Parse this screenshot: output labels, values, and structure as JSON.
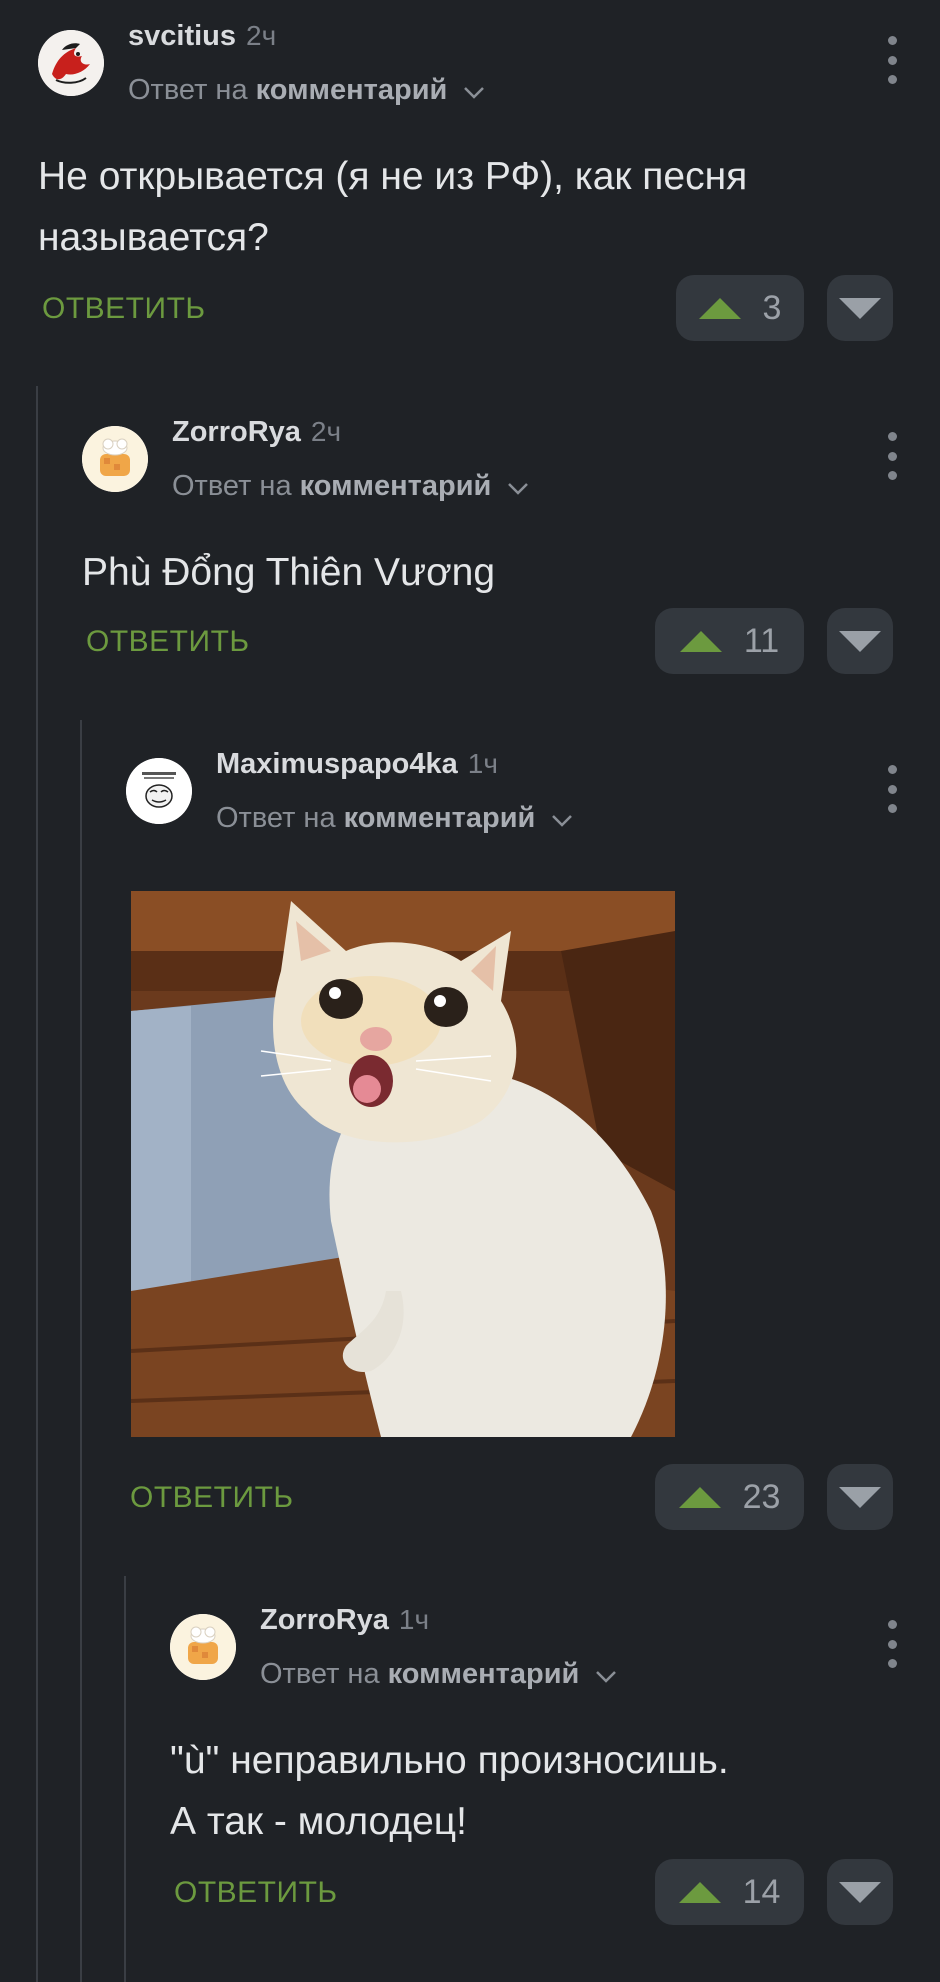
{
  "ui": {
    "reply_to_prefix": "Ответ на",
    "reply_to_target": "комментарий",
    "reply_button": "ОТВЕТИТЬ"
  },
  "colors": {
    "background": "#1f2226",
    "accent_green": "#6c9a3f",
    "vote_box": "#33383e"
  },
  "comments": [
    {
      "author": "svcitius",
      "time": "2ч",
      "text_lines": [
        "Не открывается (я не из РФ), как песня",
        "называется?"
      ],
      "rating": "3",
      "avatar_icon": "red-dragon-avatar-icon"
    },
    {
      "author": "ZorroRya",
      "time": "2ч",
      "text_lines": [
        "Phù Đổng Thiên Vương"
      ],
      "rating": "11",
      "avatar_icon": "cookie-chef-avatar-icon"
    },
    {
      "author": "Maximuspapo4ka",
      "time": "1ч",
      "image": "coughing-cat-photo",
      "rating": "23",
      "avatar_icon": "meme-face-avatar-icon"
    },
    {
      "author": "ZorroRya",
      "time": "1ч",
      "text_lines": [
        "\"ù\" неправильно произносишь.",
        "А так - молодец!"
      ],
      "rating": "14",
      "avatar_icon": "cookie-chef-avatar-icon"
    }
  ]
}
